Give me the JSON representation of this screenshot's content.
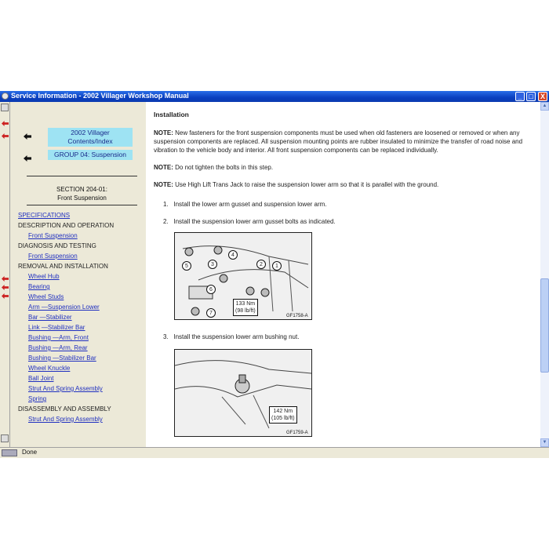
{
  "window": {
    "title": "Service Information - 2002 Villager Workshop Manual",
    "buttons": {
      "minimize": "_",
      "maximize": "□",
      "close": "X"
    }
  },
  "nav": {
    "contents_button": "2002 Villager Contents/Index",
    "group_button": "GROUP 04: Suspension",
    "section_line1": "SECTION 204-01:",
    "section_line2": "Front Suspension",
    "toc": [
      {
        "text": "SPECIFICATIONS",
        "type": "link0"
      },
      {
        "text": "DESCRIPTION AND OPERATION",
        "type": "header"
      },
      {
        "text": "Front Suspension",
        "type": "link"
      },
      {
        "text": "DIAGNOSIS AND TESTING",
        "type": "header"
      },
      {
        "text": "Front Suspension",
        "type": "link"
      },
      {
        "text": "REMOVAL AND INSTALLATION",
        "type": "header"
      },
      {
        "text": "Wheel Hub",
        "type": "link"
      },
      {
        "text": "Bearing",
        "type": "link"
      },
      {
        "text": "Wheel Studs",
        "type": "link"
      },
      {
        "text": "Arm —Suspension Lower",
        "type": "link"
      },
      {
        "text": "Bar —Stabilizer",
        "type": "link"
      },
      {
        "text": "Link —Stabilizer Bar",
        "type": "link"
      },
      {
        "text": "Bushing —Arm, Front",
        "type": "link"
      },
      {
        "text": "Bushing —Arm, Rear",
        "type": "link"
      },
      {
        "text": "Bushing —Stabilizer Bar",
        "type": "link"
      },
      {
        "text": "Wheel Knuckle",
        "type": "link"
      },
      {
        "text": "Ball Joint",
        "type": "link"
      },
      {
        "text": "Strut And Spring Assembly",
        "type": "link"
      },
      {
        "text": "Spring",
        "type": "link"
      },
      {
        "text": "DISASSEMBLY AND ASSEMBLY",
        "type": "header"
      },
      {
        "text": "Strut And Spring Assembly",
        "type": "link"
      }
    ]
  },
  "content": {
    "heading": "Installation",
    "notes": [
      {
        "label": "NOTE:",
        "text": " New fasteners for the front suspension components must be used when old fasteners are loosened or removed or when any suspension components are replaced. All suspension mounting points are rubber insulated to minimize the transfer of road noise and vibration to the vehicle body and interior. All front suspension components can be replaced individually."
      },
      {
        "label": "NOTE:",
        "text": " Do not tighten the bolts in this step."
      },
      {
        "label": "NOTE:",
        "text": " Use High Lift Trans Jack to raise the suspension lower arm so that it is parallel with the ground."
      }
    ],
    "steps": [
      {
        "num": "1.",
        "text": "Install the lower arm gusset and suspension lower arm."
      },
      {
        "num": "2.",
        "text": "Install the suspension lower arm gusset bolts as indicated."
      },
      {
        "num": "3.",
        "text": "Install the suspension lower arm bushing nut."
      }
    ],
    "figure1": {
      "torque_line1": "133 Nm",
      "torque_line2": "(98 lb/ft)",
      "caption": "GF1758-A",
      "callouts": [
        "1",
        "2",
        "3",
        "4",
        "5",
        "6",
        "7"
      ]
    },
    "figure2": {
      "torque_line1": "142 Nm",
      "torque_line2": "(105 lb/ft)",
      "caption": "GF1759-A"
    }
  },
  "status": {
    "text": "Done"
  }
}
